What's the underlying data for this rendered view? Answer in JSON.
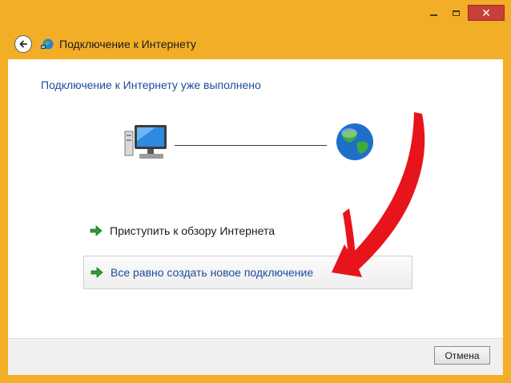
{
  "window": {
    "title": "Подключение к Интернету",
    "controls": {
      "minimize": "minimize-icon",
      "maximize": "maximize-icon",
      "close": "close-icon",
      "close_glyph": "✕"
    }
  },
  "colors": {
    "frame": "#F3AE27",
    "close_button": "#C7403A",
    "heading_text": "#1D4A9C",
    "link_text": "#1D4A9C",
    "annotation_arrow": "#E8141B"
  },
  "main": {
    "heading": "Подключение к Интернету уже выполнено",
    "icons": [
      "computer-icon",
      "globe-icon"
    ],
    "options": [
      {
        "label": "Приступить к обзору Интернета",
        "icon": "green-arrow-icon"
      },
      {
        "label": "Все равно создать новое подключение",
        "icon": "green-arrow-icon"
      }
    ]
  },
  "footer": {
    "cancel_label": "Отмена"
  }
}
